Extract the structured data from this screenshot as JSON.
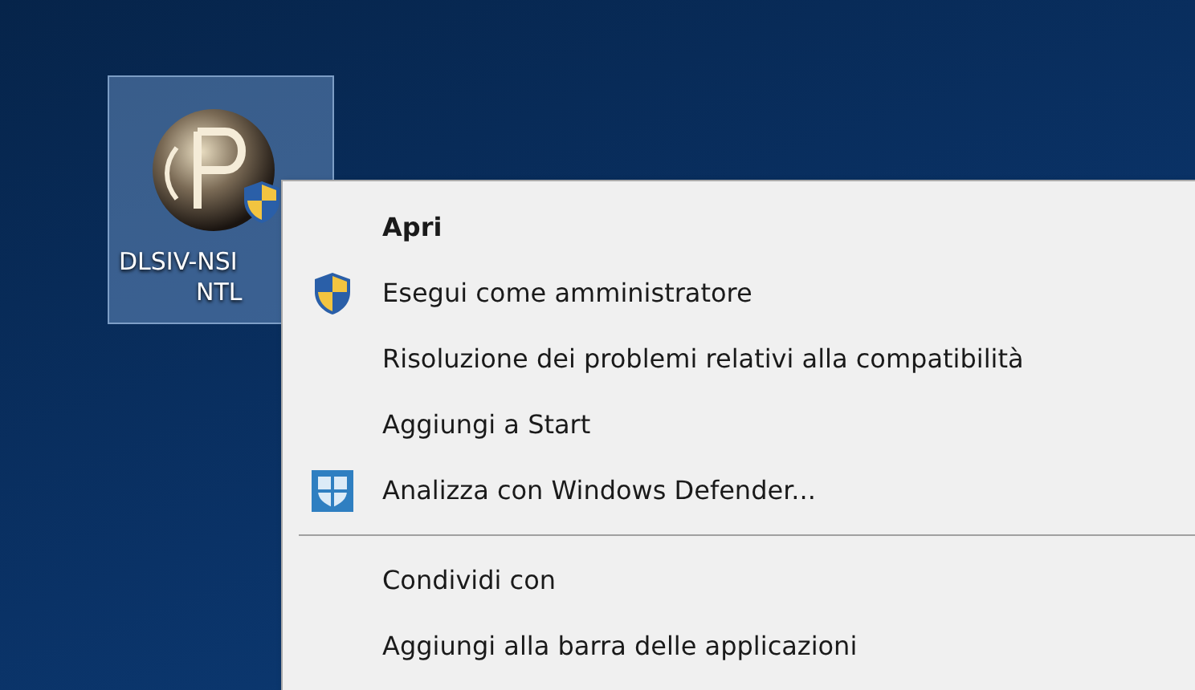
{
  "desktop_icon": {
    "label_lines": [
      "DLSIV-NSI",
      "NTL"
    ],
    "selected": true,
    "admin_badge": true
  },
  "context_menu": {
    "items": [
      {
        "kind": "item",
        "label": "Apri",
        "default": true
      },
      {
        "kind": "shield_item",
        "label": "Esegui come amministratore",
        "default": false
      },
      {
        "kind": "item",
        "label": "Risoluzione dei problemi relativi alla compatibilità",
        "default": false
      },
      {
        "kind": "item",
        "label": "Aggiungi a Start",
        "default": false
      },
      {
        "kind": "defender_item",
        "label": "Analizza con Windows Defender...",
        "default": false
      },
      {
        "kind": "separator"
      },
      {
        "kind": "item",
        "label": "Condividi con",
        "default": false
      },
      {
        "kind": "item",
        "label": "Aggiungi alla barra delle applicazioni",
        "default": false
      }
    ]
  }
}
